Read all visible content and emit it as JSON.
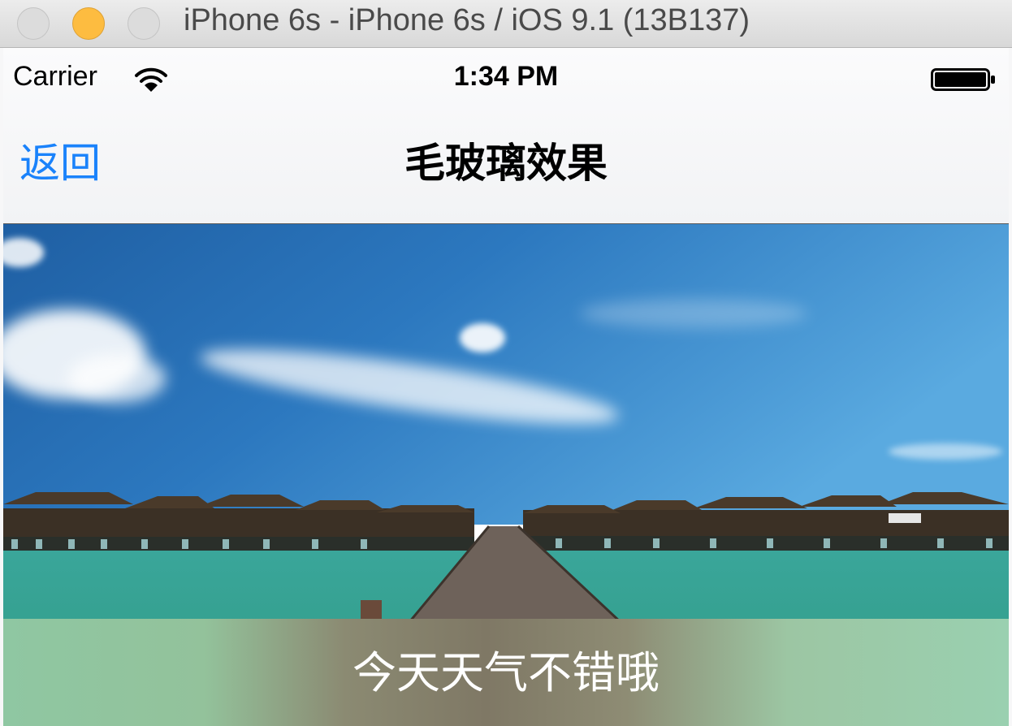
{
  "window": {
    "title": "iPhone 6s - iPhone 6s / iOS 9.1 (13B137)"
  },
  "status_bar": {
    "carrier": "Carrier",
    "time": "1:34 PM",
    "icons": [
      "wifi-icon",
      "battery-icon"
    ]
  },
  "navbar": {
    "back_label": "返回",
    "title": "毛玻璃效果",
    "accent_color": "#1a82fb"
  },
  "content": {
    "image_subject": "overwater bungalows along a wooden pier, blue sky, turquoise sea",
    "blur_label": "今天天气不错哦"
  }
}
